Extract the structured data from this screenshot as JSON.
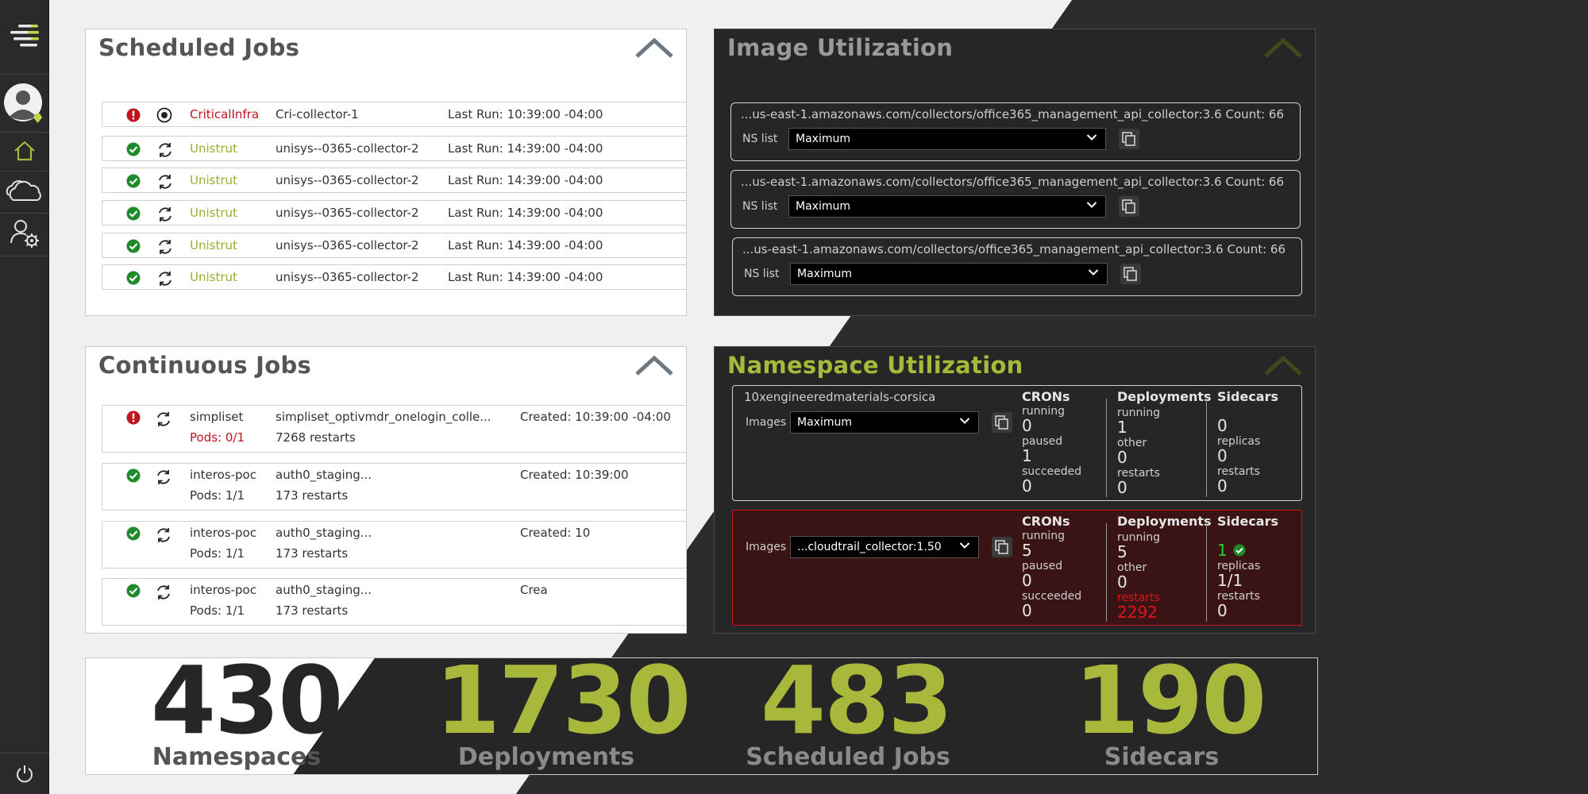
{
  "colors": {
    "accent": "#a8b83a",
    "error": "#c0141e",
    "ok": "#1e8a2a"
  },
  "sidebar": {
    "items": [
      {
        "icon": "menu-logo-icon"
      },
      {
        "icon": "user-avatar-icon"
      },
      {
        "icon": "home-icon"
      },
      {
        "icon": "clouds-icon"
      },
      {
        "icon": "user-settings-icon"
      },
      {
        "icon": "power-icon"
      }
    ]
  },
  "scheduled_jobs": {
    "title": "Scheduled Jobs",
    "rows": [
      {
        "status": "error",
        "type": "stop",
        "owner": "CriticalInfra",
        "name": "Cri-collector-1",
        "last_run": "Last Run: 10:39:00 -04:00"
      },
      {
        "status": "ok",
        "type": "refresh",
        "owner": "Unistrut",
        "name": "unisys--0365-collector-2",
        "last_run": "Last Run: 14:39:00 -04:00"
      },
      {
        "status": "ok",
        "type": "refresh",
        "owner": "Unistrut",
        "name": "unisys--0365-collector-2",
        "last_run": "Last Run: 14:39:00 -04:00"
      },
      {
        "status": "ok",
        "type": "refresh",
        "owner": "Unistrut",
        "name": "unisys--0365-collector-2",
        "last_run": "Last Run: 14:39:00 -04:00"
      },
      {
        "status": "ok",
        "type": "refresh",
        "owner": "Unistrut",
        "name": "unisys--0365-collector-2",
        "last_run": "Last Run: 14:39:00 -04:00"
      },
      {
        "status": "ok",
        "type": "refresh",
        "owner": "Unistrut",
        "name": "unisys--0365-collector-2",
        "last_run": "Last Run: 14:39:00 -04:00"
      }
    ]
  },
  "continuous_jobs": {
    "title": "Continuous Jobs",
    "rows": [
      {
        "status": "error",
        "owner": "simpliset",
        "pods": "Pods: 0/1",
        "name": "simpliset_optivmdr_onelogin_colle...",
        "restarts": "7268 restarts",
        "created": "Created: 10:39:00 -04:00"
      },
      {
        "status": "ok",
        "owner": "interos-poc",
        "pods": "Pods: 1/1",
        "name": "auth0_staging...",
        "restarts": "173 restarts",
        "created": "Created: 10:39:00"
      },
      {
        "status": "ok",
        "owner": "interos-poc",
        "pods": "Pods: 1/1",
        "name": "auth0_staging...",
        "restarts": "173 restarts",
        "created": "Created: 10"
      },
      {
        "status": "ok",
        "owner": "interos-poc",
        "pods": "Pods: 1/1",
        "name": "auth0_staging...",
        "restarts": "173 restarts",
        "created": "Crea"
      }
    ]
  },
  "image_utilization": {
    "title": "Image Utilization",
    "cards": [
      {
        "path": "...us-east-1.amazonaws.com/collectors/office365_management_api_collector:3.6",
        "count": "Count: 66",
        "ns_label": "NS list",
        "select": "Maximum"
      },
      {
        "path": "...us-east-1.amazonaws.com/collectors/office365_management_api_collector:3.6",
        "count": "Count: 66",
        "ns_label": "NS list",
        "select": "Maximum"
      },
      {
        "path": "...us-east-1.amazonaws.com/collectors/office365_management_api_collector:3.6",
        "count": "Count: 66",
        "ns_label": "NS list",
        "select": "Maximum"
      }
    ]
  },
  "namespace_utilization": {
    "title": "Namespace Utilization",
    "cards": [
      {
        "name": "10xengineeredmaterials-corsica",
        "images_label": "Images",
        "select": "Maximum",
        "crons": {
          "header": "CRONs",
          "running_label": "running",
          "running": "0",
          "paused_label": "paused",
          "paused": "1",
          "succeeded_label": "succeeded",
          "succeeded": "0"
        },
        "deployments": {
          "header": "Deployments",
          "running_label": "running",
          "running": "1",
          "other_label": "other",
          "other": "0",
          "restarts_label": "restarts",
          "restarts": "0"
        },
        "sidecars": {
          "header": "Sidecars",
          "count": "0",
          "replicas_label": "replicas",
          "replicas": "0",
          "restarts_label": "restarts",
          "restarts": "0"
        }
      },
      {
        "name": "",
        "images_label": "Images",
        "select": "...cloudtrail_collector:1.50",
        "crons": {
          "header": "CRONs",
          "running_label": "running",
          "running": "5",
          "paused_label": "paused",
          "paused": "0",
          "succeeded_label": "succeeded",
          "succeeded": "0"
        },
        "deployments": {
          "header": "Deployments",
          "running_label": "running",
          "running": "5",
          "other_label": "other",
          "other": "0",
          "restarts_label": "restarts",
          "restarts": "2292"
        },
        "sidecars": {
          "header": "Sidecars",
          "count": "1",
          "replicas_label": "replicas",
          "replicas": "1/1",
          "restarts_label": "restarts",
          "restarts": "0"
        }
      }
    ]
  },
  "stats": [
    {
      "value": "430",
      "label": "Namespaces"
    },
    {
      "value": "1730",
      "label": "Deployments"
    },
    {
      "value": "483",
      "label": "Scheduled Jobs"
    },
    {
      "value": "190",
      "label": "Sidecars"
    }
  ]
}
